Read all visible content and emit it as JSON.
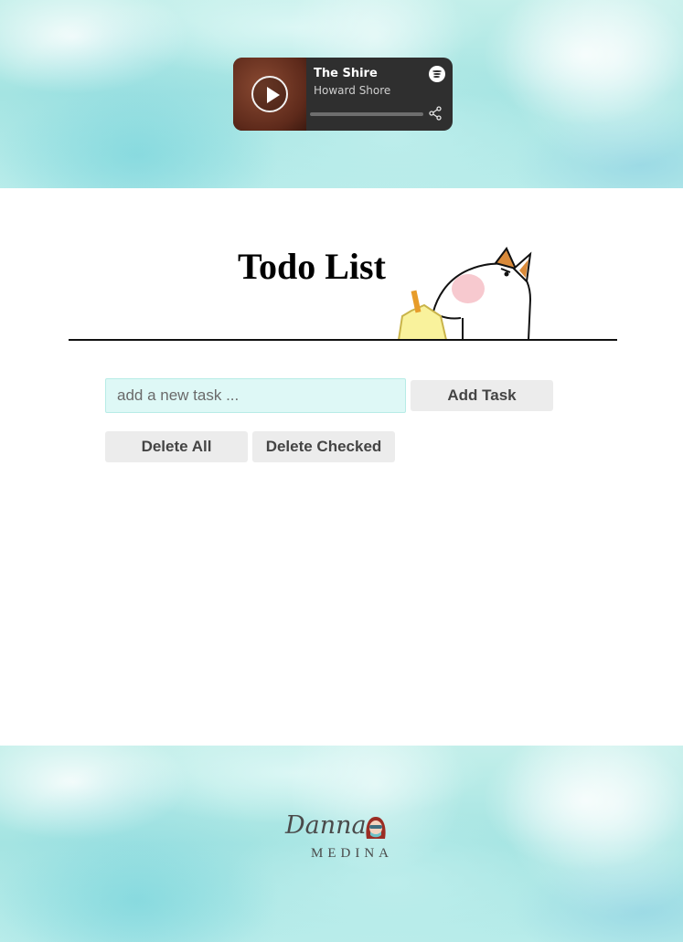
{
  "player": {
    "track_title": "The Shire",
    "track_artist": "Howard Shore",
    "progress": 0,
    "icons": [
      "play-icon",
      "spotify-icon",
      "share-icon"
    ]
  },
  "page_title": "Todo List",
  "task_input": {
    "placeholder": "add a new task ...",
    "value": ""
  },
  "buttons": {
    "add_task": "Add Task",
    "delete_all": "Delete All",
    "delete_checked": "Delete Checked"
  },
  "footer_logo": {
    "script": "Danna",
    "caps": "MEDINA"
  },
  "colors": {
    "watercolor_teal": "#a4e4e2",
    "input_bg": "#def8f6",
    "button_bg": "#ececec",
    "player_bg": "#2f2f2f"
  }
}
